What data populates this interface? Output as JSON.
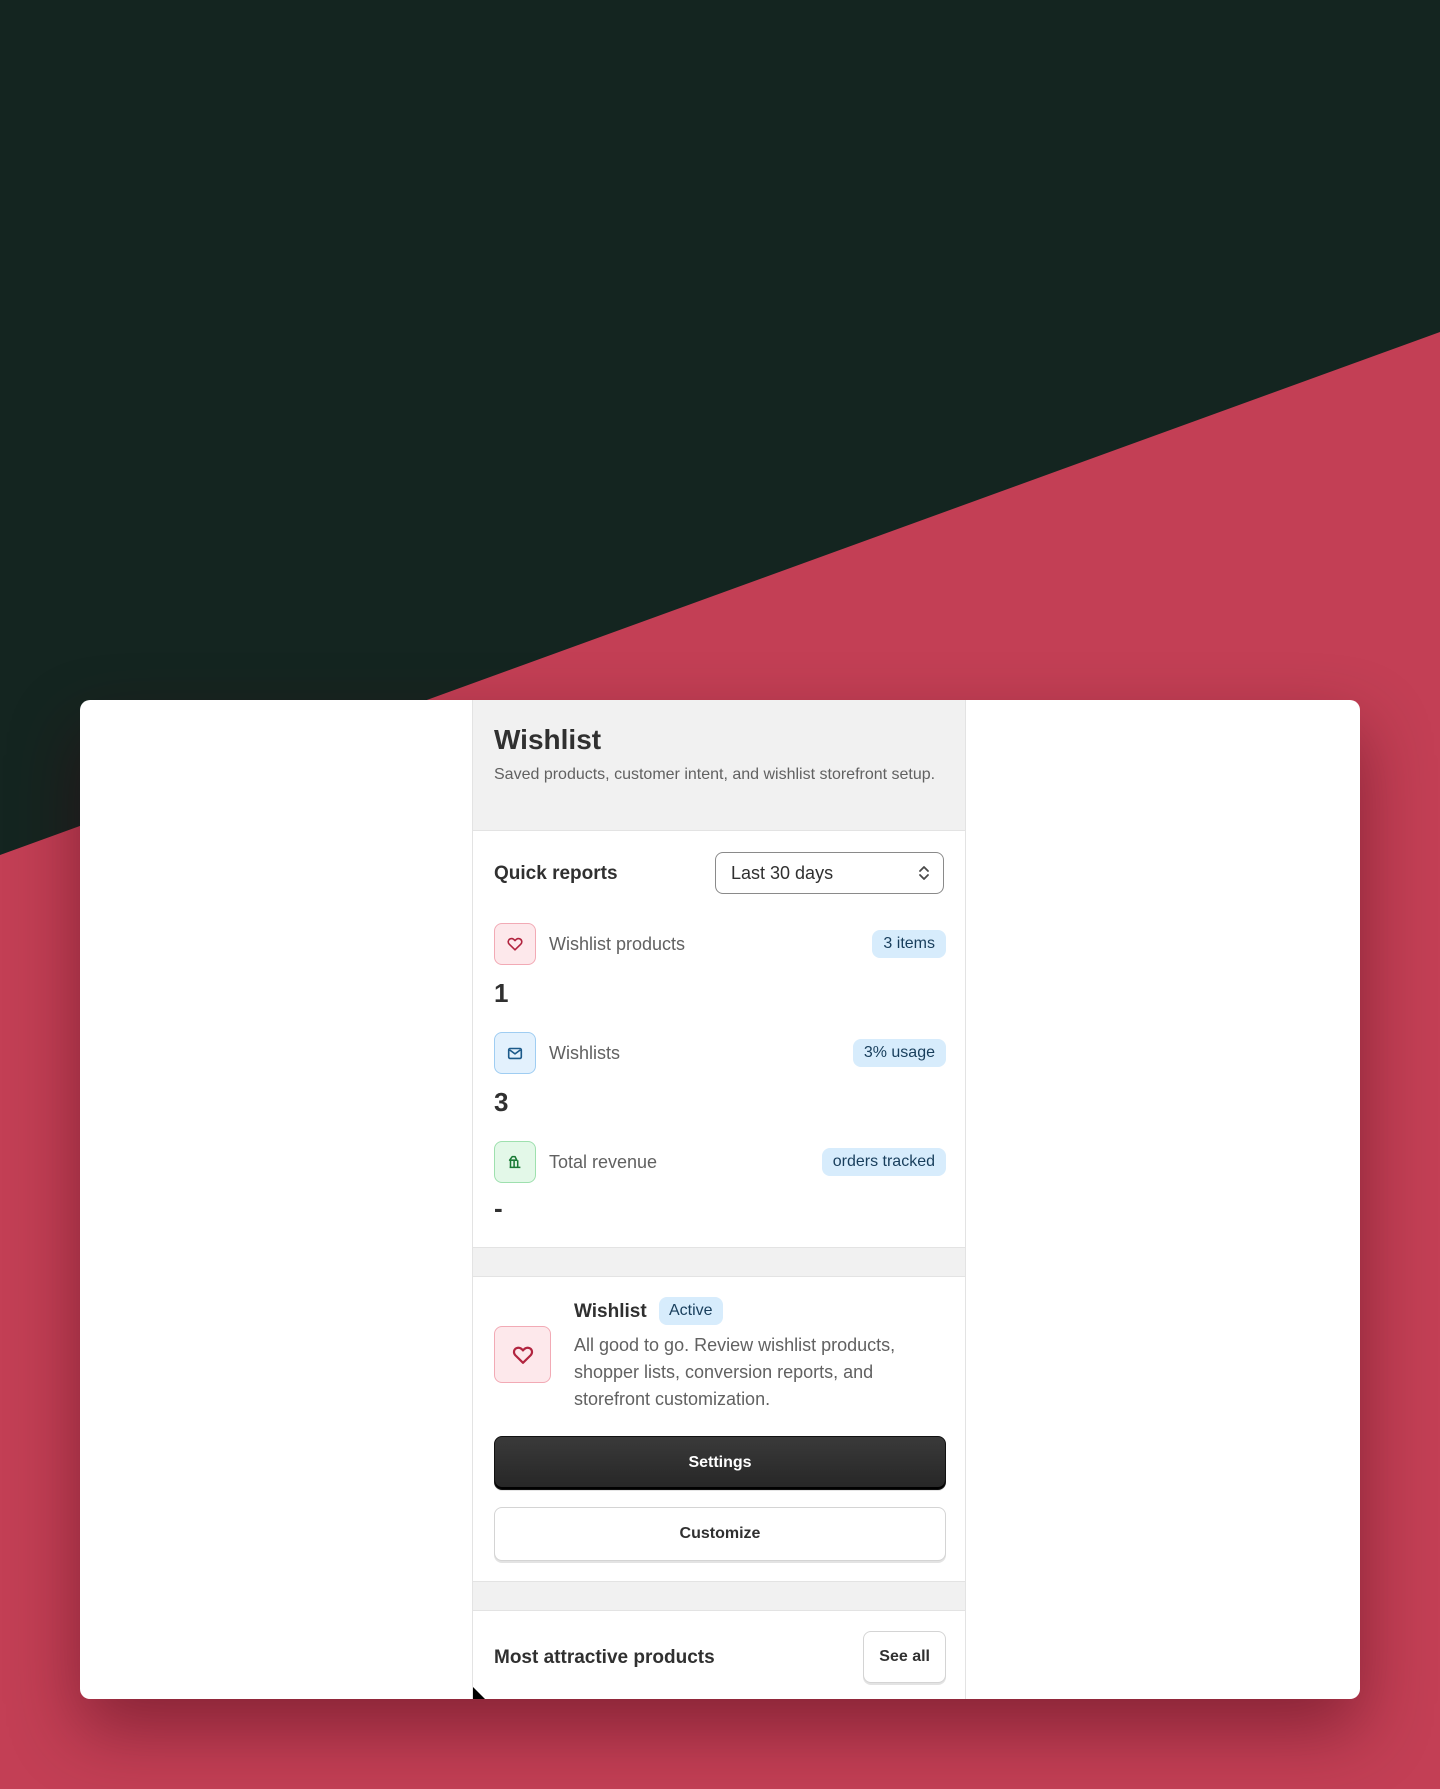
{
  "header": {
    "title": "Wishlist",
    "subtitle": "Saved products, customer intent, and wishlist storefront setup."
  },
  "quick_reports": {
    "title": "Quick reports",
    "range_select": {
      "value": "Last 30 days"
    },
    "metrics": [
      {
        "label": "Wishlist products",
        "badge": "3 items",
        "value": "1",
        "icon": "heart-icon"
      },
      {
        "label": "Wishlists",
        "badge": "3% usage",
        "value": "3",
        "icon": "mail-icon"
      },
      {
        "label": "Total revenue",
        "badge": "orders tracked",
        "value": "-",
        "icon": "bank-icon"
      }
    ]
  },
  "status": {
    "title": "Wishlist",
    "badge": "Active",
    "description": "All good to go. Review wishlist products, shopper lists, conversion reports, and storefront customization.",
    "primary_button": "Settings",
    "secondary_button": "Customize",
    "icon": "heart-icon"
  },
  "products": {
    "title": "Most attractive products",
    "see_all": "See all"
  },
  "colors": {
    "background_dark": "#142520",
    "background_accent": "#c33f55",
    "badge_bg": "#d7ecfc",
    "primary_button": "#303030"
  }
}
